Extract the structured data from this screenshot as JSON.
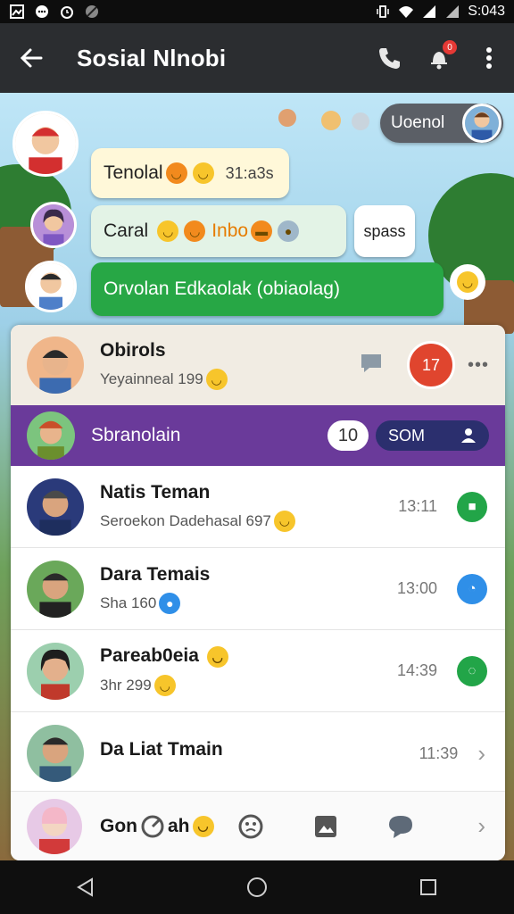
{
  "status_bar": {
    "time": "S:043",
    "left_icons": [
      "gallery-icon",
      "message-icon",
      "alarm-icon",
      "blocked-icon"
    ],
    "right_icons": [
      "vibrate-icon",
      "wifi-icon",
      "signal-icon",
      "signal-icon"
    ]
  },
  "app_bar": {
    "title": "Sosial Nlnobi",
    "notification_count": "0"
  },
  "chat": {
    "bubble_top_right": "Uoenol",
    "bubble1": {
      "text": "Tenolal",
      "time": "31:a3s"
    },
    "bubble2": {
      "text": "Caral",
      "extra": "Inbo"
    },
    "bubble3": {
      "text": "Orvolan Edkaolak (obiaolag)"
    },
    "bubble4": {
      "text": "spass"
    }
  },
  "list": {
    "pinned": {
      "name": "Obirols",
      "sub": "Yeyainneal 199",
      "badge": "17"
    },
    "highlight": {
      "name": "Sbranolain",
      "count": "10",
      "tag": "SOM"
    },
    "rows": [
      {
        "name": "Natis Teman",
        "sub": "Seroekon Dadehasal 697",
        "time": "13:11",
        "status_color": "#22a548"
      },
      {
        "name": "Dara Temais",
        "sub": "Sha 160",
        "time": "13:00",
        "status_color": "#2f8fe8"
      },
      {
        "name": "Pareab0eia",
        "sub": "3hr 299",
        "time": "14:39",
        "status_color": "#22a548"
      },
      {
        "name": "Da Liat Tmain",
        "sub": "",
        "time": "11:39",
        "status_color": ""
      }
    ],
    "bottom_item": {
      "name": "Gon",
      "name_suffix": "ah"
    }
  },
  "colors": {
    "app_bar": "#2b2d30",
    "accent_green": "#27a745",
    "accent_purple": "#6a3a9a",
    "accent_red": "#e0452e"
  }
}
